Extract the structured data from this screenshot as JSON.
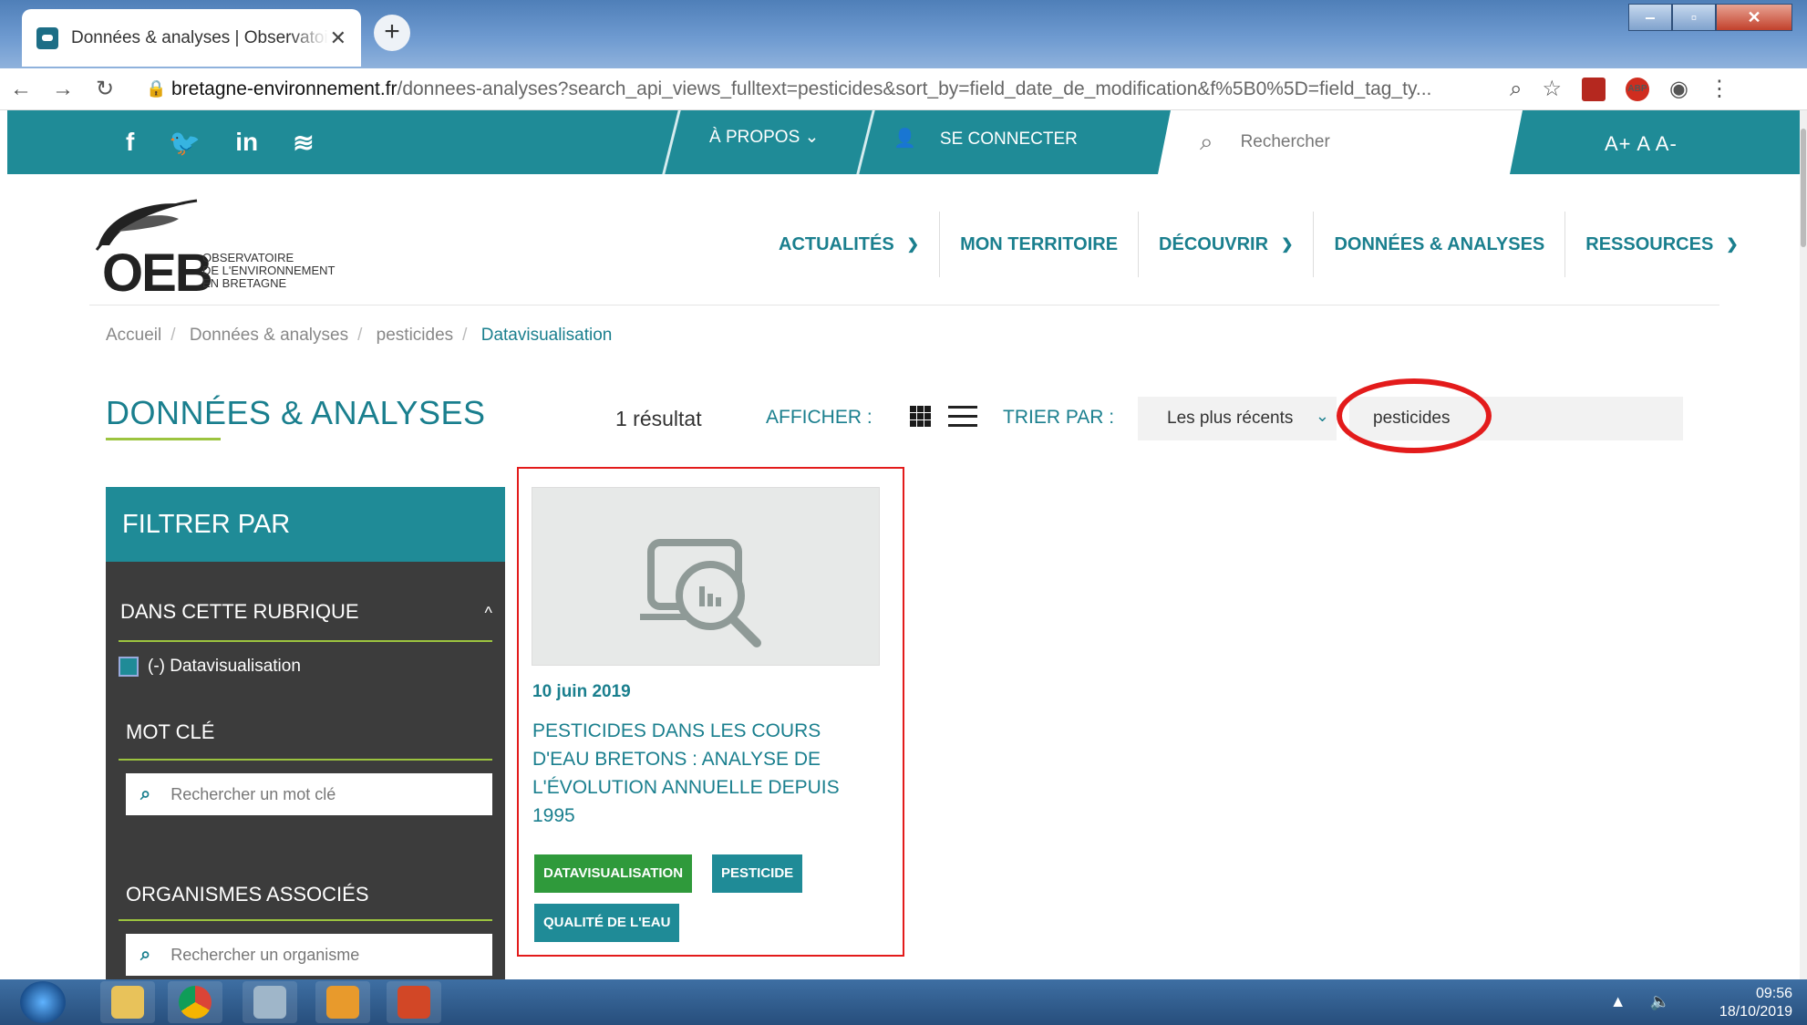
{
  "browser": {
    "tab_title": "Données & analyses | Observatoire de l'environnement en Bretagne",
    "url_domain": "bretagne-environnement.fr",
    "url_path": "/donnees-analyses?search_api_views_fulltext=pesticides&sort_by=field_date_de_modification&f%5B0%5D=field_tag_ty..."
  },
  "topbar": {
    "apropos": "À PROPOS",
    "connect": "SE CONNECTER",
    "search_placeholder": "Rechercher",
    "font_controls": "A+ A A-"
  },
  "logo": {
    "oeb": "OEB",
    "line1": "OBSERVATOIRE",
    "line2": "DE L'ENVIRONNEMENT",
    "line3": "EN BRETAGNE"
  },
  "nav": {
    "items": [
      {
        "label": "ACTUALITÉS"
      },
      {
        "label": "MON TERRITOIRE"
      },
      {
        "label": "DÉCOUVRIR"
      },
      {
        "label": "DONNÉES & ANALYSES"
      },
      {
        "label": "RESSOURCES"
      }
    ]
  },
  "breadcrumb": {
    "items": [
      "Accueil",
      "Données & analyses",
      "pesticides"
    ],
    "current": "Datavisualisation"
  },
  "main": {
    "title": "DONNÉES & ANALYSES",
    "result_count": "1 résultat",
    "afficher": "AFFICHER :",
    "trier_par": "TRIER PAR :",
    "sort_value": "Les plus récents",
    "keyword_value": "pesticides"
  },
  "sidebar": {
    "heading": "FILTRER PAR",
    "section1": "DANS CETTE RUBRIQUE",
    "checkbox_label": "(-) Datavisualisation",
    "section2": "MOT CLÉ",
    "keyword_placeholder": "Rechercher un mot clé",
    "section3": "ORGANISMES ASSOCIÉS",
    "org_placeholder": "Rechercher un organisme"
  },
  "card": {
    "date": "10 juin 2019",
    "title": "Pesticides dans les cours d'eau bretons : analyse de l'évolution annuelle depuis 1995",
    "tags": [
      "DATAVISUALISATION",
      "PESTICIDE",
      "QUALITÉ DE L'EAU"
    ]
  },
  "taskbar": {
    "time": "09:56",
    "date": "18/10/2019"
  },
  "colors": {
    "teal": "#1f8b97",
    "green_accent": "#9cc43f",
    "highlight_red": "#e31b1b"
  }
}
